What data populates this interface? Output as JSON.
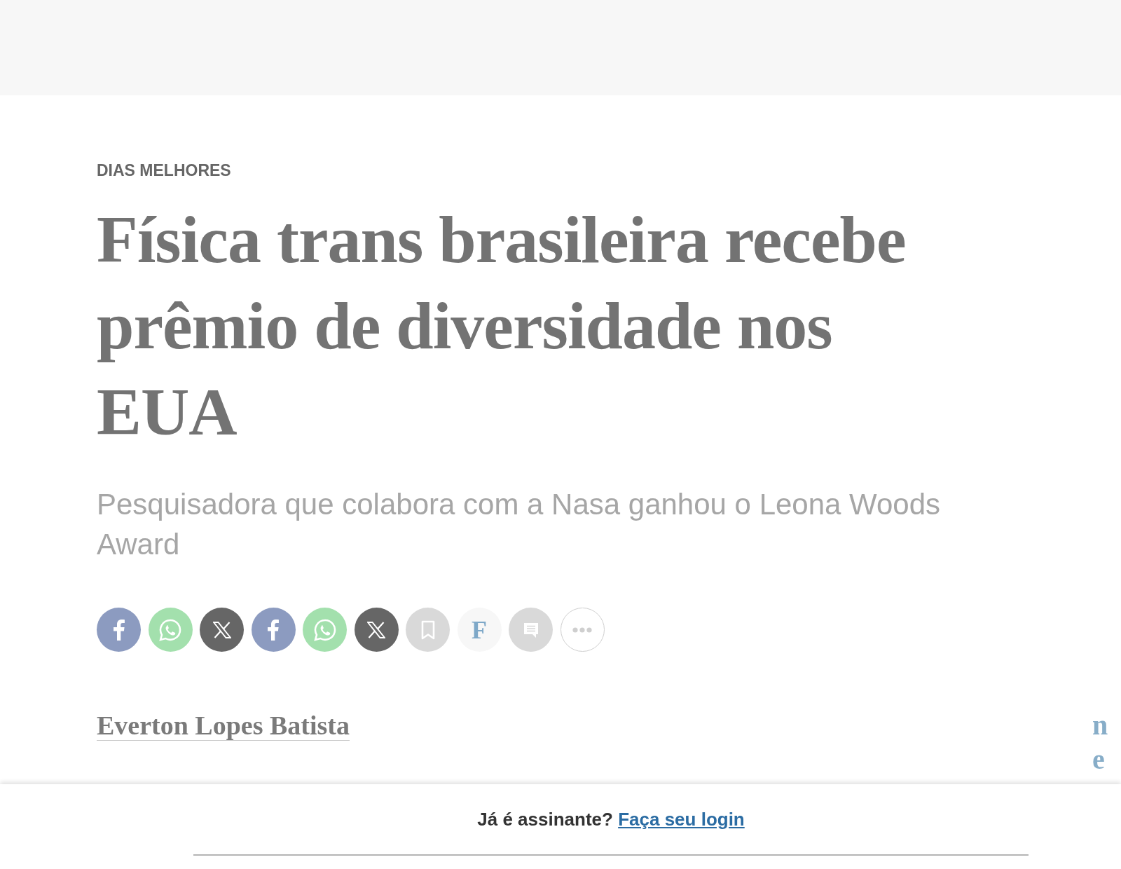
{
  "article": {
    "kicker": "DIAS MELHORES",
    "title": "Física trans brasileira recebe prêmio de diversidade nos EUA",
    "subtitle": "Pesquisadora que colabora com a Nasa ganhou o Leona Woods Award",
    "share_buttons": [
      {
        "kind": "facebook"
      },
      {
        "kind": "whatsapp"
      },
      {
        "kind": "x"
      },
      {
        "kind": "facebook"
      },
      {
        "kind": "whatsapp"
      },
      {
        "kind": "x"
      },
      {
        "kind": "bookmark"
      },
      {
        "kind": "logo",
        "label": "F"
      },
      {
        "kind": "comments"
      },
      {
        "kind": "more"
      }
    ],
    "author": "Everton Lopes Batista"
  },
  "sidebar": {
    "lines": [
      "n",
      "e"
    ]
  },
  "login_bar": {
    "prompt": "Já é assinante?",
    "link": "Faça seu login"
  }
}
